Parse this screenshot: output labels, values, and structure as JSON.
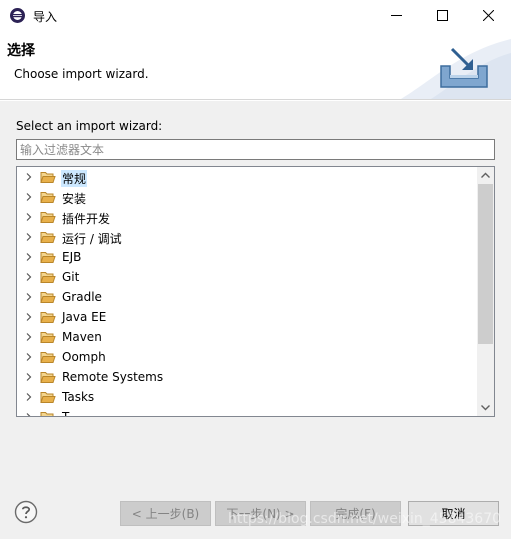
{
  "window": {
    "title": "导入",
    "icons": {
      "app": "eclipse-icon",
      "minimize": "minimize-icon",
      "maximize": "maximize-icon",
      "close": "close-icon"
    }
  },
  "header": {
    "title": "选择",
    "description": "Choose import wizard.",
    "icon": "import-wizard-icon"
  },
  "filter": {
    "label": "Select an import wizard:",
    "placeholder": "输入过滤器文本",
    "value": ""
  },
  "tree": {
    "items": [
      {
        "label": "常规",
        "selected": true
      },
      {
        "label": "安装",
        "selected": false
      },
      {
        "label": "插件开发",
        "selected": false
      },
      {
        "label": "运行 / 调试",
        "selected": false
      },
      {
        "label": "EJB",
        "selected": false
      },
      {
        "label": "Git",
        "selected": false
      },
      {
        "label": "Gradle",
        "selected": false
      },
      {
        "label": "Java EE",
        "selected": false
      },
      {
        "label": "Maven",
        "selected": false
      },
      {
        "label": "Oomph",
        "selected": false
      },
      {
        "label": "Remote Systems",
        "selected": false
      },
      {
        "label": "Tasks",
        "selected": false
      },
      {
        "label": "T…",
        "selected": false
      }
    ]
  },
  "footer": {
    "back_label": "< 上一步(B)",
    "next_label": "下一步(N) >",
    "finish_label": "完成(F)",
    "cancel_label": "取消"
  },
  "watermark": "https://blog.csdn.net/weixin_45843670",
  "colors": {
    "selection": "#cce8ff",
    "folder": "#e8b04a",
    "accent": "#0078d7"
  }
}
